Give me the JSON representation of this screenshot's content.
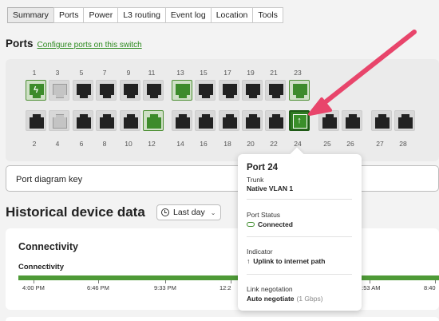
{
  "tabs": [
    "Summary",
    "Ports",
    "Power",
    "L3 routing",
    "Event log",
    "Location",
    "Tools"
  ],
  "ports_section": {
    "title": "Ports",
    "configure_link": "Configure ports on this switch",
    "top_row": [
      {
        "label": "1",
        "state": "green",
        "glyph": "bolt"
      },
      {
        "label": "3",
        "state": "disabled"
      },
      {
        "label": "5",
        "state": "black"
      },
      {
        "label": "7",
        "state": "black"
      },
      {
        "label": "9",
        "state": "black"
      },
      {
        "label": "11",
        "state": "black"
      },
      {
        "label": "13",
        "state": "green"
      },
      {
        "label": "15",
        "state": "black"
      },
      {
        "label": "17",
        "state": "black"
      },
      {
        "label": "19",
        "state": "black"
      },
      {
        "label": "21",
        "state": "black"
      },
      {
        "label": "23",
        "state": "green"
      }
    ],
    "bottom_row": [
      {
        "label": "2",
        "state": "black"
      },
      {
        "label": "4",
        "state": "disabled"
      },
      {
        "label": "6",
        "state": "black"
      },
      {
        "label": "8",
        "state": "black"
      },
      {
        "label": "10",
        "state": "black"
      },
      {
        "label": "12",
        "state": "green"
      },
      {
        "label": "14",
        "state": "black"
      },
      {
        "label": "16",
        "state": "black"
      },
      {
        "label": "18",
        "state": "black"
      },
      {
        "label": "20",
        "state": "black"
      },
      {
        "label": "22",
        "state": "black"
      },
      {
        "label": "24",
        "state": "selected",
        "glyph": "uplink"
      },
      {
        "label": "25",
        "state": "black"
      },
      {
        "label": "26",
        "state": "black"
      },
      {
        "label": "27",
        "state": "black"
      },
      {
        "label": "28",
        "state": "black"
      }
    ],
    "key_label": "Port diagram key"
  },
  "historical": {
    "title": "Historical device data",
    "range_button": "Last day",
    "range_icon": "clock-icon"
  },
  "connectivity": {
    "title": "Connectivity",
    "subtitle": "Connectivity",
    "bar_color": "#4e9a37",
    "ticks": [
      "4:00 PM",
      "6:46 PM",
      "9:33 PM",
      "12:2",
      "5:53 AM",
      "8:40"
    ]
  },
  "tooltip": {
    "title": "Port 24",
    "mode_label": "Trunk",
    "mode_value": "Native VLAN 1",
    "status_label": "Port Status",
    "status_value": "Connected",
    "indicator_label": "Indicator",
    "indicator_value": "Uplink to internet path",
    "link_label": "Link negotation",
    "link_value": "Auto negotiate",
    "link_speed": "(1 Gbps)"
  },
  "colors": {
    "accent_green": "#3d8b2b",
    "annotation_arrow": "#e8456b"
  }
}
